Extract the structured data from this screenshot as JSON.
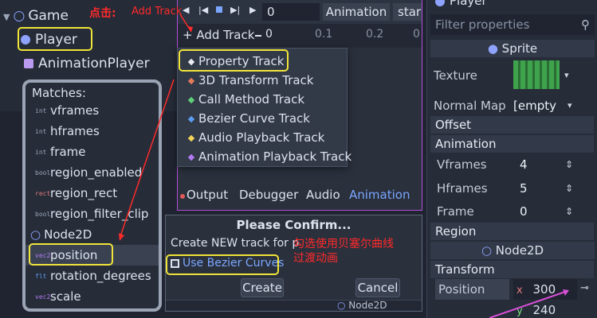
{
  "scene": {
    "game_label": "Game",
    "player_label": "Player",
    "animplayer_label": "AnimationPlayer"
  },
  "toolbar": {
    "frame_value": "0",
    "animation_label": "Animation",
    "start_label": "star",
    "add_track_label": "+ Add Track",
    "ruler": [
      "0",
      "0.1",
      "0.2",
      "0"
    ]
  },
  "track_menu": {
    "items": [
      {
        "label": "Property Track",
        "color": "#e9ecf2"
      },
      {
        "label": "3D Transform Track",
        "color": "#e07b5a"
      },
      {
        "label": "Call Method Track",
        "color": "#5ecf7a"
      },
      {
        "label": "Bezier Curve Track",
        "color": "#5a9cf0"
      },
      {
        "label": "Audio Playback Track",
        "color": "#f0d35a"
      },
      {
        "label": "Animation Playback Track",
        "color": "#b07af0"
      }
    ]
  },
  "bottom_tabs": [
    "Output",
    "Debugger",
    "Audio",
    "Animation"
  ],
  "matches": {
    "title": "Matches:",
    "items": [
      {
        "label": "vframes",
        "icon": "int"
      },
      {
        "label": "hframes",
        "icon": "int"
      },
      {
        "label": "frame",
        "icon": "int"
      },
      {
        "label": "region_enabled",
        "icon": "bool"
      },
      {
        "label": "region_rect",
        "icon": "rect"
      },
      {
        "label": "region_filter_clip",
        "icon": "bool"
      },
      {
        "label": "Node2D",
        "icon": "circle"
      },
      {
        "label": "position",
        "icon": "vec2"
      },
      {
        "label": "rotation_degrees",
        "icon": "flt"
      },
      {
        "label": "scale",
        "icon": "vec2"
      }
    ]
  },
  "dialog": {
    "title": "Please Confirm...",
    "message": "Create NEW track for p",
    "checkbox_label": "Use Bezier Curves",
    "create_label": "Create",
    "cancel_label": "Cancel",
    "bg_node_label": "Node2D"
  },
  "inspector": {
    "header": "Player",
    "filter_placeholder": "Filter properties",
    "sprite_label": "Sprite",
    "texture_label": "Texture",
    "normal_map_label": "Normal Map",
    "normal_map_value": "[empty",
    "offset_label": "Offset",
    "animation_section": "Animation",
    "vframes_label": "Vframes",
    "vframes_value": "4",
    "hframes_label": "Hframes",
    "hframes_value": "5",
    "frame_label": "Frame",
    "frame_value": "0",
    "region_label": "Region",
    "node2d_label": "Node2D",
    "transform_label": "Transform",
    "position_label": "Position",
    "x_label": "x",
    "x_value": "300",
    "y_label": "y",
    "y_value": "240"
  },
  "annotations": {
    "click_text": "点击:",
    "add_track_text": "Add Track",
    "bezier_hint_1": "勾选使用贝塞尔曲线",
    "bezier_hint_2": "过渡动画"
  }
}
